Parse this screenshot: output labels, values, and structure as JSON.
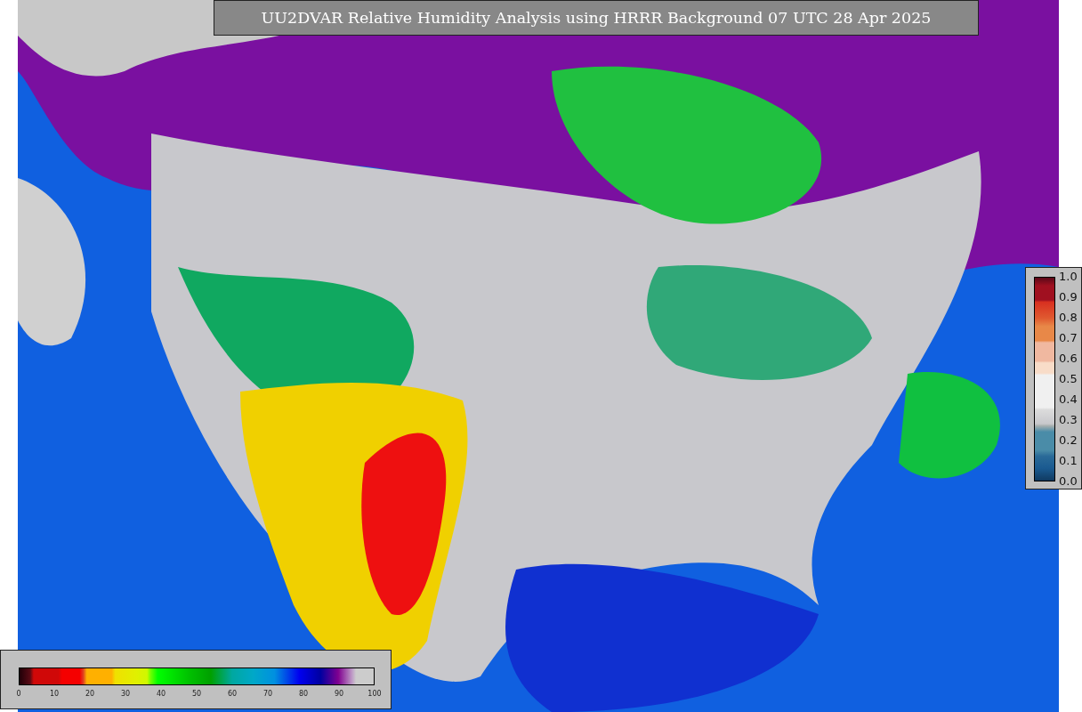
{
  "title": "UU2DVAR Relative Humidity Analysis using HRRR Background 07 UTC 28 Apr 2025",
  "humidity_colorbar": {
    "ticks": [
      "0",
      "10",
      "20",
      "30",
      "40",
      "50",
      "60",
      "70",
      "80",
      "90",
      "100"
    ]
  },
  "observation_colorbar": {
    "ticks": [
      "1.0",
      "0.9",
      "0.8",
      "0.7",
      "0.6",
      "0.5",
      "0.4",
      "0.3",
      "0.2",
      "0.1",
      "0.0"
    ]
  }
}
